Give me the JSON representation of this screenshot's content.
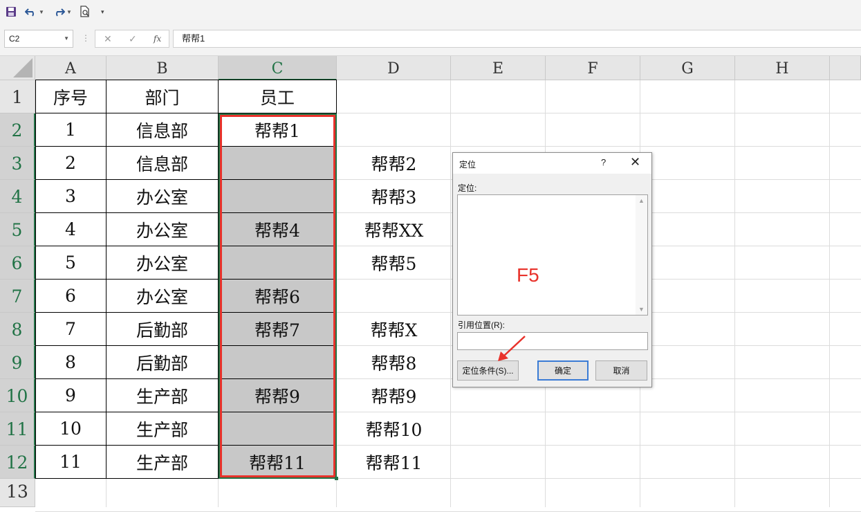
{
  "toolbar": {
    "icons": [
      "save-icon",
      "undo-icon",
      "redo-icon",
      "print-preview-icon",
      "customize-icon"
    ]
  },
  "formula_bar": {
    "name_box": "C2",
    "cancel_symbol": "✕",
    "enter_symbol": "✓",
    "fx_label": "fx",
    "value": "帮帮1"
  },
  "sheet": {
    "columns": [
      "A",
      "B",
      "C",
      "D",
      "E",
      "F",
      "G",
      "H"
    ],
    "rows": [
      "1",
      "2",
      "3",
      "4",
      "5",
      "6",
      "7",
      "8",
      "9",
      "10",
      "11",
      "12",
      "13"
    ],
    "selected_column": "C",
    "selected_range": "C2:C12",
    "header": {
      "a": "序号",
      "b": "部门",
      "c": "员工"
    },
    "data": [
      {
        "a": "1",
        "b": "信息部",
        "c": "帮帮1",
        "d": ""
      },
      {
        "a": "2",
        "b": "信息部",
        "c": "",
        "d": "帮帮2"
      },
      {
        "a": "3",
        "b": "办公室",
        "c": "",
        "d": "帮帮3"
      },
      {
        "a": "4",
        "b": "办公室",
        "c": "帮帮4",
        "d": "帮帮XX"
      },
      {
        "a": "5",
        "b": "办公室",
        "c": "",
        "d": "帮帮5"
      },
      {
        "a": "6",
        "b": "办公室",
        "c": "帮帮6",
        "d": ""
      },
      {
        "a": "7",
        "b": "后勤部",
        "c": "帮帮7",
        "d": "帮帮X"
      },
      {
        "a": "8",
        "b": "后勤部",
        "c": "",
        "d": "帮帮8"
      },
      {
        "a": "9",
        "b": "生产部",
        "c": "帮帮9",
        "d": "帮帮9"
      },
      {
        "a": "10",
        "b": "生产部",
        "c": "",
        "d": "帮帮10"
      },
      {
        "a": "11",
        "b": "生产部",
        "c": "帮帮11",
        "d": "帮帮11"
      }
    ]
  },
  "dialog": {
    "title": "定位",
    "help": "?",
    "close": "✕",
    "goto_label": "定位:",
    "annotation": "F5",
    "reference_label": "引用位置(R):",
    "reference_value": "",
    "special_button": "定位条件(S)...",
    "ok_button": "确定",
    "cancel_button": "取消"
  },
  "colors": {
    "selection_green": "#217346",
    "annotation_red": "#e8322b",
    "cell_gray": "#c8c8c8"
  }
}
